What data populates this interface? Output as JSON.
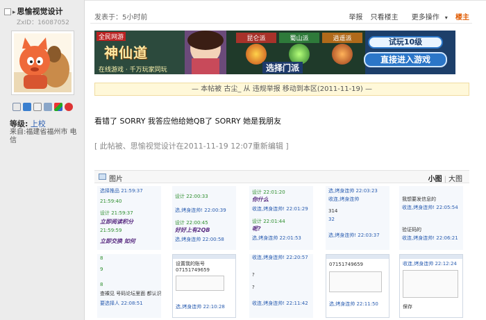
{
  "user": {
    "name": "思愉视觉设计",
    "uid": "ZxID：16087052",
    "level_label": "等级:",
    "level_value": "上校",
    "from": "来自:福建省福州市 电信"
  },
  "post": {
    "time": "发表于：5小时前",
    "actions": [
      "举报",
      "只看楼主",
      "更多操作"
    ],
    "floor": "楼主",
    "notice": "— 本帖被 古尘_ 从 违规举报 移动到本区(2011-11-19) —",
    "text": "看错了 SORRY 我答应他给她QB了  SORRY 她是我朋友",
    "edited": "[ 此帖被、思愉视觉设计在2011-11-19 12:07重新编辑 ]"
  },
  "banner": {
    "corner": "全民网游",
    "title": "神仙道",
    "sub": "在线游戏 · 千万玩家同玩",
    "sects": [
      "昆仑派",
      "蜀山派",
      "逍遥派"
    ],
    "choose": "选择门派",
    "btn_trial": "试玩10级",
    "btn_enter": "直接进入游戏"
  },
  "images": {
    "title": "图片",
    "small": "小图",
    "large": "大图",
    "thumbs_row1": [
      [
        "选择推品 21:59:37",
        "21:59:40",
        "设计 21:59:37",
        "21:59:59",
        "立即阅读积分",
        "立即交换 如何"
      ],
      [
        "设计 22:00:33",
        "选,烤身连帅! 22:00:39",
        "设计 22:00:45",
        "好好上有2QB",
        "选,烤身连帅 22:00:58"
      ],
      [
        "设计 22:01:20",
        "你什么",
        "收连,烤身连帅! 22:01:29",
        "设计 22:01:44",
        "呢?",
        "选,烤身连帅 22:01:53"
      ],
      [
        "选,烤身连帅 22:03:23",
        "收连,烤身连帅",
        "314",
        "32",
        "选,烤身连帅! 22:03:37"
      ],
      [
        "我想要发信息的",
        "收连,烤身连帅! 22:05:54",
        "验证码的",
        "收连,烤身连帅! 22:06:21"
      ]
    ],
    "thumbs_row2": [
      [
        "8",
        "9",
        "8",
        "查裸见 号码论坛里面 都认识你",
        "要选择人 22:08:51"
      ],
      [
        "设置我的账号",
        "07151749659",
        "选,烤身连帅 22:10:28"
      ],
      [
        "收连,烤身连帅! 22:20:57",
        "?",
        "?",
        "收连,烤身连帅! 22:11:42"
      ],
      [
        "07151749659",
        "选,烤身连帅 22:11:50"
      ],
      [
        "收连,烤身连帅 22:12:24",
        "保存"
      ]
    ]
  },
  "colors": {
    "left_bg": "#ececec",
    "link": "#2a5db0",
    "floor": "#e05a00",
    "notice_bg": "#fff8d9"
  }
}
